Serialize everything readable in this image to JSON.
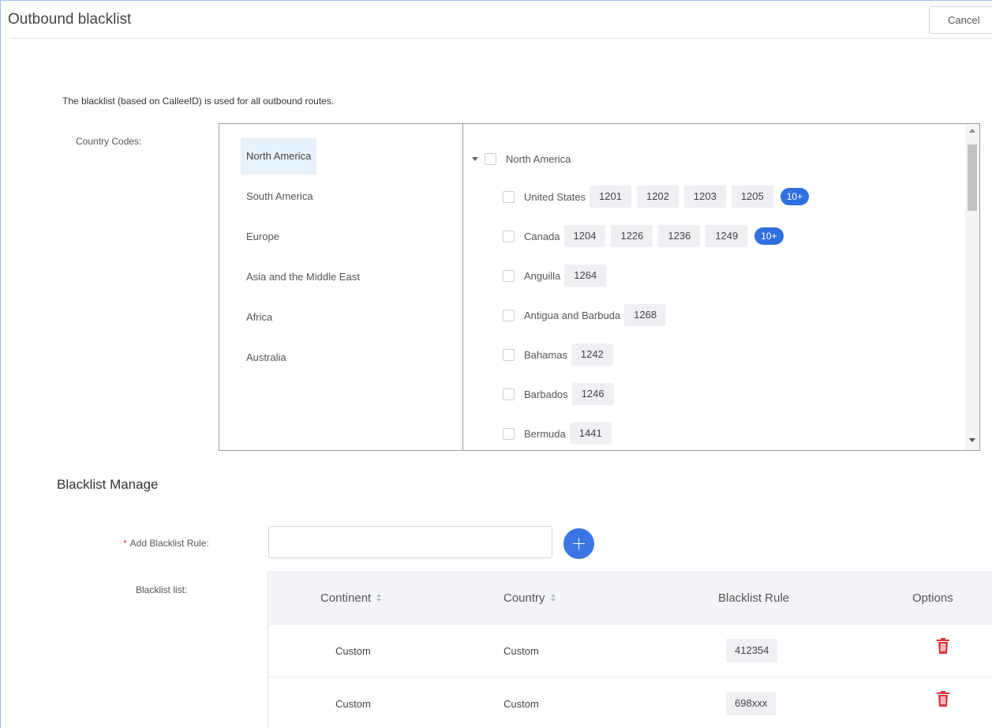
{
  "header": {
    "title": "Outbound blacklist",
    "cancel_label": "Cancel"
  },
  "description": "The blacklist (based on CalleeID) is used for all outbound routes.",
  "country_codes": {
    "label": "Country Codes:",
    "continents": [
      {
        "label": "North America",
        "active": true
      },
      {
        "label": "South America",
        "active": false
      },
      {
        "label": "Europe",
        "active": false
      },
      {
        "label": "Asia and the Middle East",
        "active": false
      },
      {
        "label": "Africa",
        "active": false
      },
      {
        "label": "Australia",
        "active": false
      }
    ],
    "tree_root": "North America",
    "countries": [
      {
        "name": "United States",
        "codes": [
          "1201",
          "1202",
          "1203",
          "1205"
        ],
        "more": "10+"
      },
      {
        "name": "Canada",
        "codes": [
          "1204",
          "1226",
          "1236",
          "1249"
        ],
        "more": "10+"
      },
      {
        "name": "Anguilla",
        "codes": [
          "1264"
        ]
      },
      {
        "name": "Antigua and Barbuda",
        "codes": [
          "1268"
        ]
      },
      {
        "name": "Bahamas",
        "codes": [
          "1242"
        ]
      },
      {
        "name": "Barbados",
        "codes": [
          "1246"
        ]
      },
      {
        "name": "Bermuda",
        "codes": [
          "1441"
        ]
      }
    ]
  },
  "blacklist_manage": {
    "title": "Blacklist Manage",
    "add_rule_label": "Add Blacklist Rule:",
    "add_rule_required_mark": "*",
    "add_rule_value": "",
    "list_label": "Blacklist list:",
    "columns": [
      "Continent",
      "Country",
      "Blacklist Rule",
      "Options"
    ],
    "rows": [
      {
        "continent": "Custom",
        "country": "Custom",
        "rule": "412354"
      },
      {
        "continent": "Custom",
        "country": "Custom",
        "rule": "698xxx"
      }
    ]
  },
  "colors": {
    "accent": "#2f6fe0",
    "delete": "#d9373d",
    "selected_bg": "#e7f1fb",
    "chip_bg": "#eef0f3"
  },
  "icons": {
    "add": "plus-icon",
    "delete": "trash-icon",
    "expand": "caret-down-icon"
  }
}
